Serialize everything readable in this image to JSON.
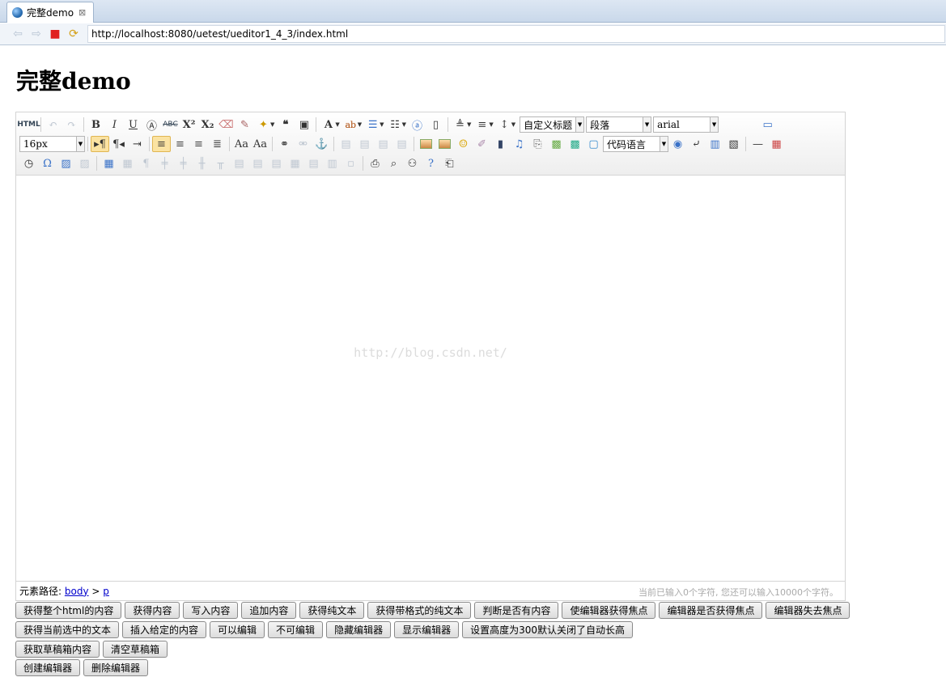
{
  "browser": {
    "tab_title": "完整demo",
    "tab_close": "⊠",
    "url": "http://localhost:8080/uetest/ueditor1_4_3/index.html"
  },
  "page": {
    "heading": "完整demo"
  },
  "editor": {
    "toolbar": {
      "source_label": "HTML",
      "title_select": "自定义标题",
      "paragraph_select": "段落",
      "font_family_select": "arial",
      "font_size_select": "16px",
      "code_language_select": "代码语言"
    },
    "watermark": "http://blog.csdn.net/",
    "statusbar": {
      "path_label": "元素路径:",
      "path_body": "body",
      "path_sep": ">",
      "path_p": "p",
      "word_count": "当前已输入0个字符, 您还可以输入10000个字符。"
    }
  },
  "buttons": {
    "row1": [
      "获得整个html的内容",
      "获得内容",
      "写入内容",
      "追加内容",
      "获得纯文本",
      "获得带格式的纯文本",
      "判断是否有内容",
      "使编辑器获得焦点",
      "编辑器是否获得焦点",
      "编辑器失去焦点"
    ],
    "row2": [
      "获得当前选中的文本",
      "插入给定的内容",
      "可以编辑",
      "不可编辑",
      "隐藏编辑器",
      "显示编辑器",
      "设置高度为300默认关闭了自动长高"
    ],
    "row3": [
      "获取草稿箱内容",
      "清空草稿箱"
    ],
    "row4": [
      "创建编辑器",
      "删除编辑器"
    ]
  }
}
